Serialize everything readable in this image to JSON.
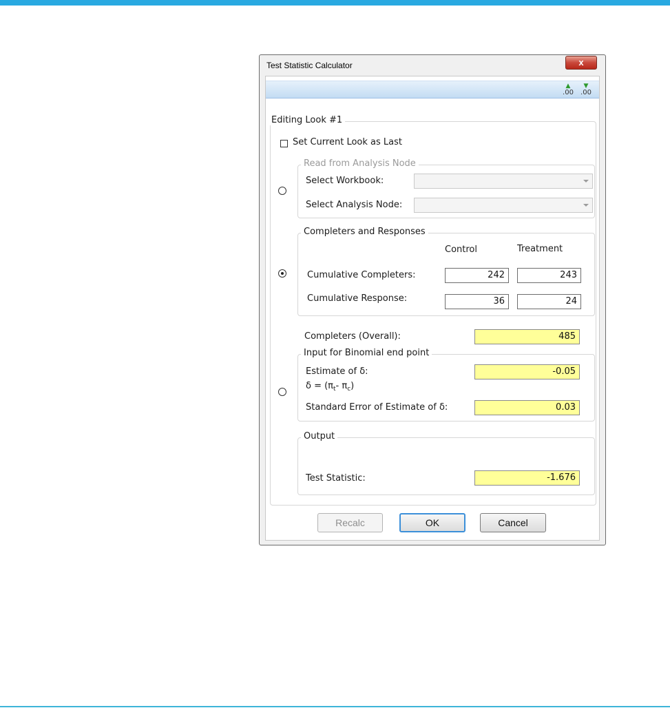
{
  "dialog": {
    "title": "Test Statistic Calculator",
    "close_label": "x"
  },
  "toolbar": {
    "icon_increase_decimals": "increase-decimals-icon",
    "icon_decrease_decimals": "decrease-decimals-icon",
    "icon_text": ".00"
  },
  "look": {
    "legend": "Editing Look #1",
    "set_last_label": "Set Current Look as Last",
    "set_last_checked": false
  },
  "analysis_node": {
    "legend": "Read from Analysis Node",
    "workbook_label": "Select Workbook:",
    "workbook_value": "",
    "node_label": "Select Analysis Node:",
    "node_value": "",
    "selected": false
  },
  "completers": {
    "legend": "Completers and Responses",
    "selected": true,
    "col_control": "Control",
    "col_treatment": "Treatment",
    "rows": [
      {
        "label": "Cumulative Completers:",
        "control": "242",
        "treatment": "243"
      },
      {
        "label": "Cumulative Response:",
        "control": "36",
        "treatment": "24"
      }
    ]
  },
  "binomial": {
    "overall_label": "Completers (Overall):",
    "overall_value": "485",
    "legend": "Input for Binomial end point",
    "estimate_label": "Estimate of δ:",
    "delta_def_prefix": "δ = (π",
    "delta_def_t": "t",
    "delta_def_mid": "- π",
    "delta_def_c": "c",
    "delta_def_suffix": ")",
    "estimate_value": "-0.05",
    "se_label": "Standard Error of Estimate of δ:",
    "se_value": "0.03",
    "selected": false
  },
  "output": {
    "legend": "Output",
    "stat_label": "Test Statistic:",
    "stat_value": "-1.676"
  },
  "buttons": {
    "recalc": "Recalc",
    "ok": "OK",
    "cancel": "Cancel"
  },
  "colors": {
    "accent_bar": "#29a9e1",
    "readonly_field": "#ffff99",
    "close_button": "#c9483b"
  }
}
